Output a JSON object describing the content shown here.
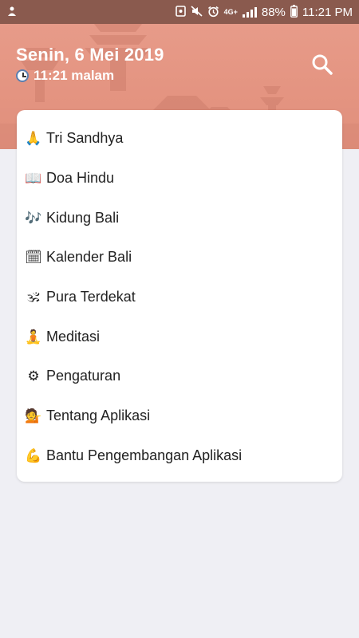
{
  "status_bar": {
    "network": "4G+",
    "battery": "88%",
    "time": "11:21 PM"
  },
  "header": {
    "date": "Senin, 6 Mei 2019",
    "time": "11:21 malam",
    "background_color": "#e49481"
  },
  "menu": {
    "items": [
      {
        "label": "Tri Sandhya",
        "icon": "praying-hands-icon",
        "glyph": "🙏"
      },
      {
        "label": "Doa Hindu",
        "icon": "open-book-icon",
        "glyph": "📖"
      },
      {
        "label": "Kidung Bali",
        "icon": "music-notes-icon",
        "glyph": "🎶"
      },
      {
        "label": "Kalender Bali",
        "icon": "calendar-icon",
        "glyph": "🗓"
      },
      {
        "label": "Pura Terdekat",
        "icon": "om-icon",
        "glyph": "🕉"
      },
      {
        "label": "Meditasi",
        "icon": "meditation-icon",
        "glyph": "🧘"
      },
      {
        "label": "Pengaturan",
        "icon": "settings-icon",
        "glyph": "⚙"
      },
      {
        "label": "Tentang Aplikasi",
        "icon": "info-person-icon",
        "glyph": "💁"
      },
      {
        "label": "Bantu Pengembangan Aplikasi",
        "icon": "flexed-biceps-icon",
        "glyph": "💪"
      }
    ]
  }
}
